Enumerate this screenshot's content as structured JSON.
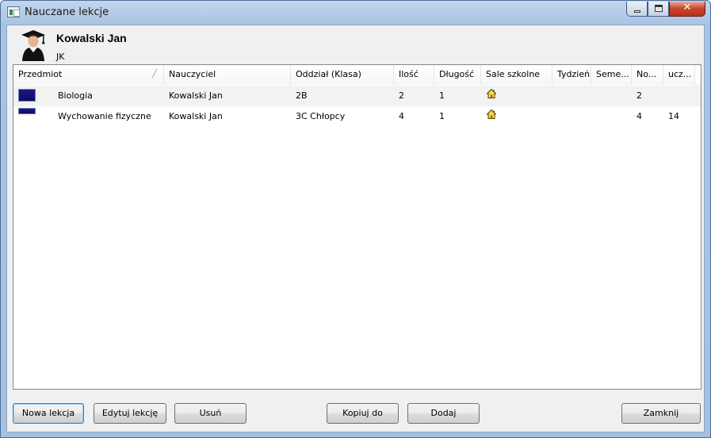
{
  "window": {
    "title": "Nauczane lekcje"
  },
  "user": {
    "name": "Kowalski Jan",
    "initials": "JK"
  },
  "table": {
    "columns": [
      "Przedmiot",
      "Nauczyciel",
      "Oddział (Klasa)",
      "Ilość",
      "Długość",
      "Sale szkolne",
      "Tydzień",
      "Seme...",
      "No...",
      "ucz..."
    ],
    "rows": [
      {
        "subject": "Biologia",
        "teacher": "Kowalski Jan",
        "class": "2B",
        "count": "2",
        "length": "1",
        "rooms_icon": "house-icon",
        "week": "",
        "semester": "",
        "no": "2",
        "ucz": ""
      },
      {
        "subject": "Wychowanie fizyczne",
        "teacher": "Kowalski Jan",
        "class": "3C Chłopcy",
        "count": "4",
        "length": "1",
        "rooms_icon": "house-icon",
        "week": "",
        "semester": "",
        "no": "4",
        "ucz": "14"
      }
    ]
  },
  "buttons": {
    "new_lesson": "Nowa lekcja",
    "edit_lesson": "Edytuj lekcję",
    "delete": "Usuń",
    "copy_to": "Kopiuj do",
    "add": "Dodaj",
    "close": "Zamknij"
  },
  "colors": {
    "subject_color": "#10107a",
    "titlebar": "#b9cfe9",
    "close_button": "#c7432b"
  }
}
